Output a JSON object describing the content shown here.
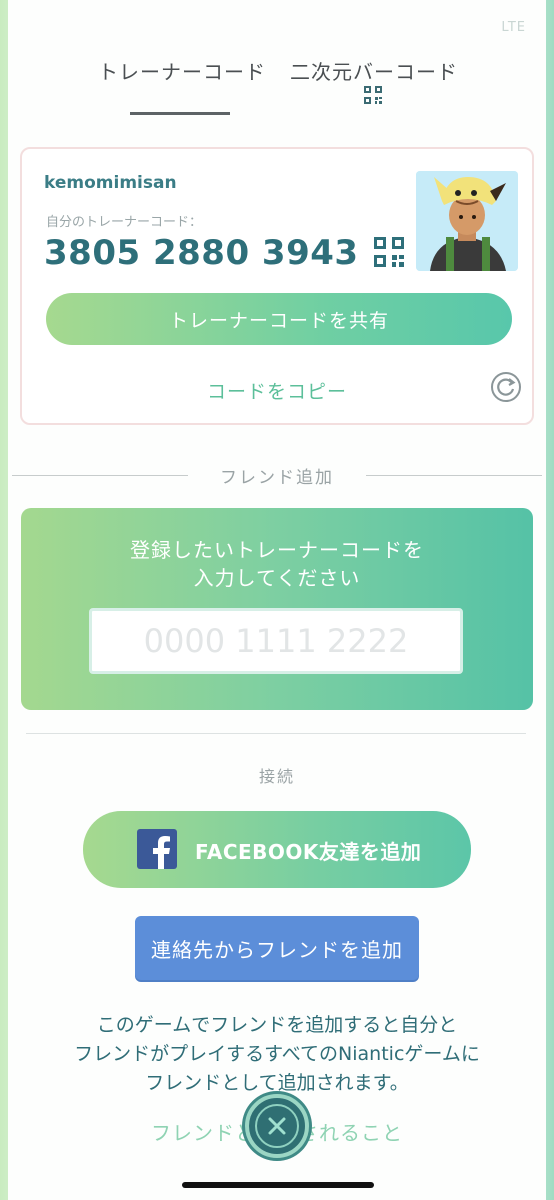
{
  "status": {
    "text": "LTE"
  },
  "tabs": [
    {
      "label": "トレーナーコード"
    },
    {
      "label": "二次元バーコード"
    }
  ],
  "card": {
    "username": "kemomimisan",
    "code_label": "自分のトレーナーコード：",
    "code_value": "3805 2880 3943",
    "share_label": "トレーナーコードを共有",
    "copy_label": "コードをコピー"
  },
  "friend_add": {
    "section_label": "フレンド追加",
    "prompt_line1": "登録したいトレーナーコードを",
    "prompt_line2": "入力してください",
    "input_placeholder": "0000 1111 2222",
    "input_value": ""
  },
  "connect": {
    "section_label": "接続",
    "facebook_label": "FACEBOOK友達を追加",
    "contacts_label": "連絡先からフレンドを追加"
  },
  "info": {
    "line1": "このゲームでフレンドを追加すると自分と",
    "line2": "フレンドがプレイするすべてのNianticゲームに",
    "line3": "フレンドとして追加されます。"
  },
  "footer": {
    "about_label": "フレンドとは？されること"
  },
  "colors": {
    "accent_green": "#6fcfa3",
    "text_teal": "#2e6f7a",
    "contacts_blue": "#5c8ed9",
    "facebook_blue": "#3b5998"
  },
  "icons": [
    "qr-code-icon",
    "refresh-icon",
    "facebook-icon",
    "close-icon"
  ]
}
